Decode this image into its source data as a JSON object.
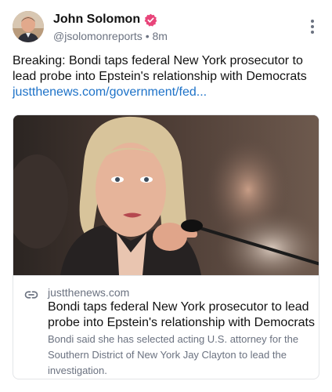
{
  "author": {
    "display_name": "John Solomon",
    "handle": "@jsolomonreports",
    "separator": "•",
    "time_ago": "8m",
    "verified_color": "#e8457a"
  },
  "post": {
    "text": "Breaking: Bondi taps federal New York prosecutor to lead probe into Epstein's relationship with Democrats",
    "link_text": "justthenews.com/government/fed...",
    "link_color": "#1d72c8"
  },
  "card": {
    "domain": "justthenews.com",
    "title": "Bondi taps federal New York prosecutor to lead probe into Epstein's relationship with Democrats",
    "description": "Bondi said she has selected acting U.S. attorney for the Southern District of New York Jay Clayton to lead the investigation."
  },
  "icons": {
    "more": "more-vertical-icon",
    "verified": "verified-badge-icon",
    "link": "link-icon"
  }
}
